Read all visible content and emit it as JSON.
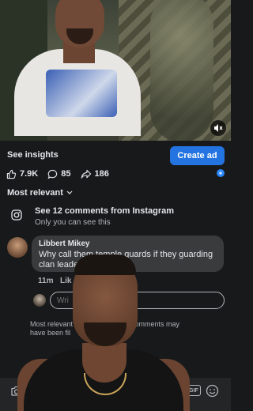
{
  "header": {
    "see_insights": "See insights",
    "create_ad": "Create ad"
  },
  "stats": {
    "likes": "7.9K",
    "comments": "85",
    "shares": "186"
  },
  "sort": {
    "label": "Most relevant"
  },
  "instagram": {
    "title": "See 12 comments from Instagram",
    "subtitle": "Only you can see this"
  },
  "comment": {
    "author": "Libbert Mikey",
    "text": "Why call them temple guards if they guarding clan leade",
    "time": "11m",
    "like": "Lik"
  },
  "reply": {
    "placeholder": "Wri"
  },
  "notice": {
    "line1": "Most relevant",
    "line1_end": "ome comments may",
    "line2": "have been fil"
  },
  "composer": {
    "gif": "GIF"
  },
  "colors": {
    "background": "#18191a",
    "accent": "#2374e1",
    "bubble": "#3a3b3c",
    "muted_text": "#b0b3b8"
  }
}
